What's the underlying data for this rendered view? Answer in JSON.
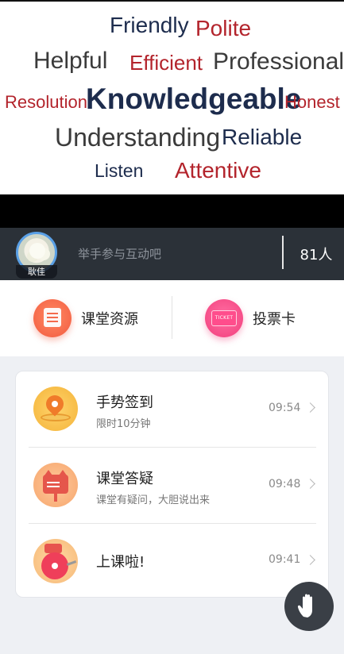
{
  "slide": {
    "words": [
      {
        "text": "Friendly"
      },
      {
        "text": "Polite"
      },
      {
        "text": "Helpful"
      },
      {
        "text": "Efficient"
      },
      {
        "text": "Professional"
      },
      {
        "text": "Resolution"
      },
      {
        "text": "Knowledgeable"
      },
      {
        "text": "Honest"
      },
      {
        "text": "Understanding"
      },
      {
        "text": "Reliable"
      },
      {
        "text": "Listen"
      },
      {
        "text": "Attentive"
      }
    ]
  },
  "livebar": {
    "user_name": "耿佳",
    "raise_hand_prompt": "举手参与互动吧",
    "participant_count": "81人",
    "accent_color": "#5aa0e6"
  },
  "quick_actions": [
    {
      "label": "课堂资源",
      "icon": "document-icon"
    },
    {
      "label": "投票卡",
      "icon": "ticket-icon",
      "icon_text": "TICKET"
    }
  ],
  "activities": [
    {
      "title": "手势签到",
      "subtitle": "限时10分钟",
      "time": "09:54",
      "icon": "location-pin-icon"
    },
    {
      "title": "课堂答疑",
      "subtitle": "课堂有疑问，大胆说出来",
      "time": "09:48",
      "icon": "cat-sign-icon"
    },
    {
      "title": "上课啦!",
      "subtitle": "",
      "time": "09:41",
      "icon": "bell-icon"
    }
  ],
  "floating_button": {
    "icon": "raise-hand-icon"
  }
}
